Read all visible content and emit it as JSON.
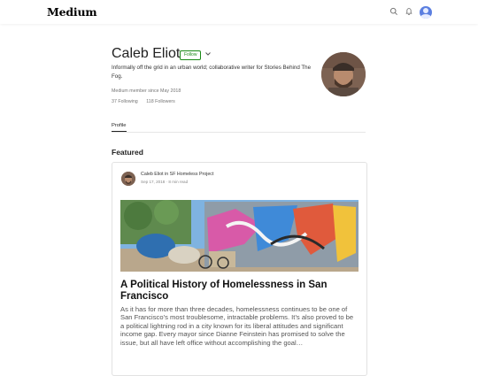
{
  "header": {
    "logo": "Medium",
    "icons": [
      "search-icon",
      "bell-icon",
      "user-avatar-icon"
    ],
    "avatar_color": "#5b7fe0"
  },
  "profile": {
    "name": "Caleb Eliot",
    "follow_label": "Follow",
    "bio": "Informally off the grid in an urban world; collaborative writer for Stories Behind The Fog.",
    "member_since": "Medium member since May 2018",
    "following": "37 Following",
    "followers": "118 Followers",
    "tab": "Profile"
  },
  "featured": {
    "heading": "Featured",
    "author_line": "Caleb Eliot in SF Homeless Project",
    "meta": "Sep 17, 2018 · 8 min read",
    "title": "A Political History of Homelessness in San Francisco",
    "excerpt": "As it has for more than three decades, homelessness continues to be one of San Francisco’s most troublesome, intractable problems. It’s also proved to be a political lightning rod in a city known for its liberal attitudes and significant income gap. Every mayor since Dianne Feinstein has promised to solve the issue, but all have left office without accomplishing the goal…"
  },
  "colors": {
    "accent_green": "#1a8917"
  }
}
